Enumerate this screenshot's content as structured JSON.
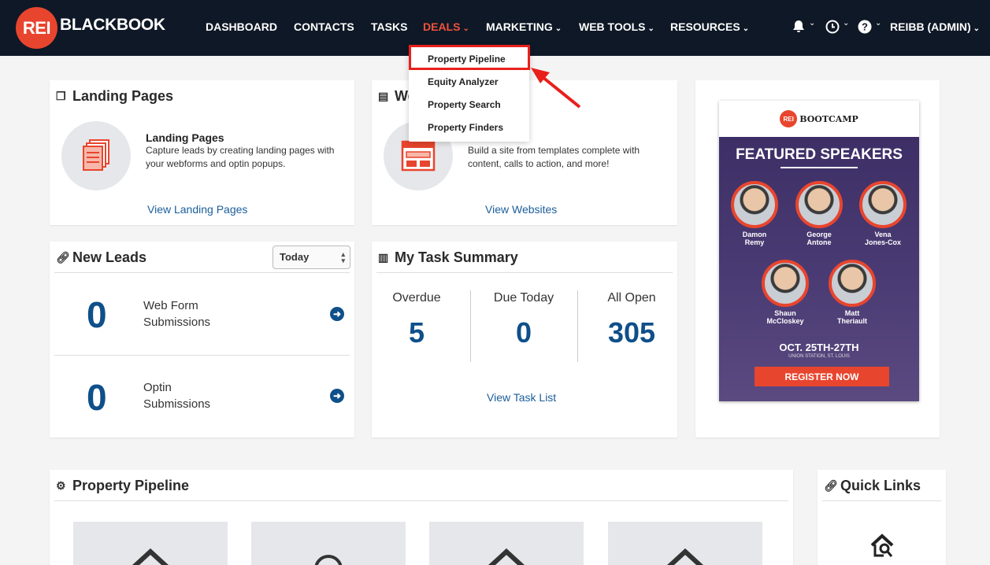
{
  "brand": {
    "logo_mark": "REI",
    "logo_text": "BLACKBOOK",
    "accent": "#e8452e",
    "nav_bg": "#0f1826"
  },
  "nav": {
    "dashboard": "DASHBOARD",
    "contacts": "CONTACTS",
    "tasks": "TASKS",
    "deals": "DEALS",
    "marketing": "MARKETING",
    "web_tools": "WEB TOOLS",
    "resources": "RESOURCES",
    "user": "REIBB (ADMIN)",
    "icons": [
      "bell-icon",
      "clock-icon",
      "help-icon"
    ]
  },
  "deals_menu": [
    "Property Pipeline",
    "Equity Analyzer",
    "Property Search",
    "Property Finders"
  ],
  "landing_pages": {
    "title": "Landing Pages",
    "heading": "Landing Pages",
    "description": "Capture leads by creating landing pages with your webforms and optin popups.",
    "link": "View Landing Pages"
  },
  "websites": {
    "title": "We",
    "description": "Build a site from templates complete with content, calls to action, and more!",
    "link": "View Websites"
  },
  "new_leads": {
    "title": "New Leads",
    "filter": "Today",
    "rows": [
      {
        "count": "0",
        "line1": "Web Form",
        "line2": "Submissions"
      },
      {
        "count": "0",
        "line1": "Optin",
        "line2": "Submissions"
      }
    ]
  },
  "tasks": {
    "title": "My Task Summary",
    "overdue_label": "Overdue",
    "overdue": "5",
    "due_today_label": "Due Today",
    "due_today": "0",
    "all_open_label": "All Open",
    "all_open": "305",
    "link": "View Task List"
  },
  "ad": {
    "logo_mark": "REI",
    "logo_text": "BOOTCAMP",
    "title": "FEATURED SPEAKERS",
    "speakers": [
      {
        "first": "Damon",
        "last": "Remy"
      },
      {
        "first": "George",
        "last": "Antone"
      },
      {
        "first": "Vena",
        "last": "Jones-Cox"
      },
      {
        "first": "Shaun",
        "last": "McCloskey"
      },
      {
        "first": "Matt",
        "last": "Theriault"
      }
    ],
    "date": "OCT. 25TH-27TH",
    "venue": "UNION STATION, ST. LOUIS",
    "cta": "REGISTER NOW"
  },
  "pipeline": {
    "title": "Property Pipeline"
  },
  "quick_links": {
    "title": "Quick Links"
  }
}
